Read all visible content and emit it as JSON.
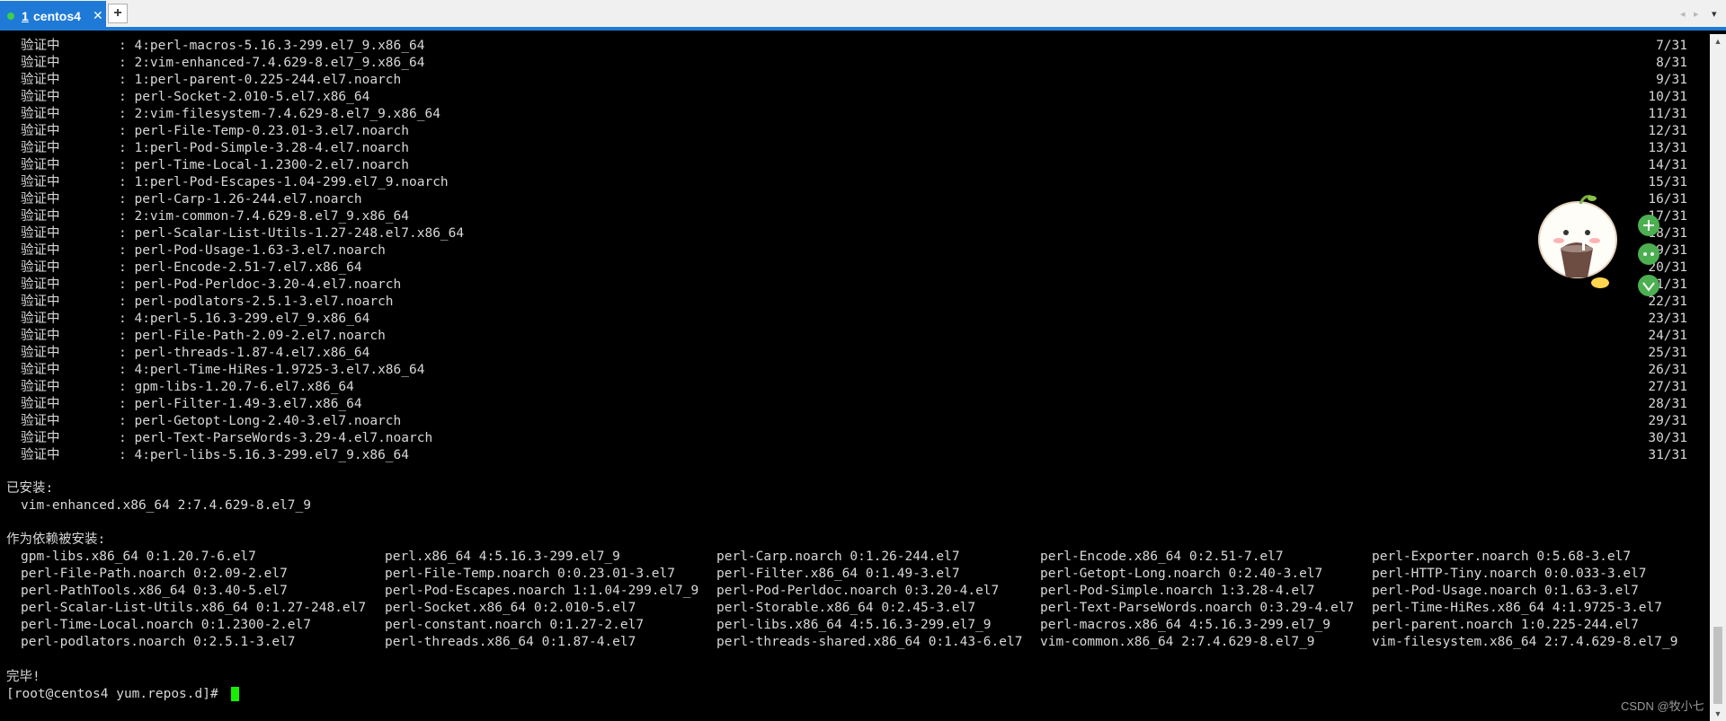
{
  "tab": {
    "number": "1",
    "name": "centos4",
    "close": "✕",
    "add": "+"
  },
  "tabbar_nav": {
    "left": "◂",
    "right": "▸",
    "menu": "▾"
  },
  "verify_rows": [
    {
      "label": "验证中",
      "pkg": ": 4:perl-macros-5.16.3-299.el7_9.x86_64",
      "progress": "7/31"
    },
    {
      "label": "验证中",
      "pkg": ": 2:vim-enhanced-7.4.629-8.el7_9.x86_64",
      "progress": "8/31"
    },
    {
      "label": "验证中",
      "pkg": ": 1:perl-parent-0.225-244.el7.noarch",
      "progress": "9/31"
    },
    {
      "label": "验证中",
      "pkg": ": perl-Socket-2.010-5.el7.x86_64",
      "progress": "10/31"
    },
    {
      "label": "验证中",
      "pkg": ": 2:vim-filesystem-7.4.629-8.el7_9.x86_64",
      "progress": "11/31"
    },
    {
      "label": "验证中",
      "pkg": ": perl-File-Temp-0.23.01-3.el7.noarch",
      "progress": "12/31"
    },
    {
      "label": "验证中",
      "pkg": ": 1:perl-Pod-Simple-3.28-4.el7.noarch",
      "progress": "13/31"
    },
    {
      "label": "验证中",
      "pkg": ": perl-Time-Local-1.2300-2.el7.noarch",
      "progress": "14/31"
    },
    {
      "label": "验证中",
      "pkg": ": 1:perl-Pod-Escapes-1.04-299.el7_9.noarch",
      "progress": "15/31"
    },
    {
      "label": "验证中",
      "pkg": ": perl-Carp-1.26-244.el7.noarch",
      "progress": "16/31"
    },
    {
      "label": "验证中",
      "pkg": ": 2:vim-common-7.4.629-8.el7_9.x86_64",
      "progress": "17/31"
    },
    {
      "label": "验证中",
      "pkg": ": perl-Scalar-List-Utils-1.27-248.el7.x86_64",
      "progress": "18/31"
    },
    {
      "label": "验证中",
      "pkg": ": perl-Pod-Usage-1.63-3.el7.noarch",
      "progress": "19/31"
    },
    {
      "label": "验证中",
      "pkg": ": perl-Encode-2.51-7.el7.x86_64",
      "progress": "20/31"
    },
    {
      "label": "验证中",
      "pkg": ": perl-Pod-Perldoc-3.20-4.el7.noarch",
      "progress": "21/31"
    },
    {
      "label": "验证中",
      "pkg": ": perl-podlators-2.5.1-3.el7.noarch",
      "progress": "22/31"
    },
    {
      "label": "验证中",
      "pkg": ": 4:perl-5.16.3-299.el7_9.x86_64",
      "progress": "23/31"
    },
    {
      "label": "验证中",
      "pkg": ": perl-File-Path-2.09-2.el7.noarch",
      "progress": "24/31"
    },
    {
      "label": "验证中",
      "pkg": ": perl-threads-1.87-4.el7.x86_64",
      "progress": "25/31"
    },
    {
      "label": "验证中",
      "pkg": ": 4:perl-Time-HiRes-1.9725-3.el7.x86_64",
      "progress": "26/31"
    },
    {
      "label": "验证中",
      "pkg": ": gpm-libs-1.20.7-6.el7.x86_64",
      "progress": "27/31"
    },
    {
      "label": "验证中",
      "pkg": ": perl-Filter-1.49-3.el7.x86_64",
      "progress": "28/31"
    },
    {
      "label": "验证中",
      "pkg": ": perl-Getopt-Long-2.40-3.el7.noarch",
      "progress": "29/31"
    },
    {
      "label": "验证中",
      "pkg": ": perl-Text-ParseWords-3.29-4.el7.noarch",
      "progress": "30/31"
    },
    {
      "label": "验证中",
      "pkg": ": 4:perl-libs-5.16.3-299.el7_9.x86_64",
      "progress": "31/31"
    }
  ],
  "installed": {
    "heading": "已安装:",
    "packages": [
      "vim-enhanced.x86_64 2:7.4.629-8.el7_9"
    ]
  },
  "dependencies": {
    "heading": "作为依赖被安装:",
    "rows": [
      [
        "gpm-libs.x86_64 0:1.20.7-6.el7",
        "perl.x86_64 4:5.16.3-299.el7_9",
        "perl-Carp.noarch 0:1.26-244.el7",
        "perl-Encode.x86_64 0:2.51-7.el7",
        "perl-Exporter.noarch 0:5.68-3.el7"
      ],
      [
        "perl-File-Path.noarch 0:2.09-2.el7",
        "perl-File-Temp.noarch 0:0.23.01-3.el7",
        "perl-Filter.x86_64 0:1.49-3.el7",
        "perl-Getopt-Long.noarch 0:2.40-3.el7",
        "perl-HTTP-Tiny.noarch 0:0.033-3.el7"
      ],
      [
        "perl-PathTools.x86_64 0:3.40-5.el7",
        "perl-Pod-Escapes.noarch 1:1.04-299.el7_9",
        "perl-Pod-Perldoc.noarch 0:3.20-4.el7",
        "perl-Pod-Simple.noarch 1:3.28-4.el7",
        "perl-Pod-Usage.noarch 0:1.63-3.el7"
      ],
      [
        "perl-Scalar-List-Utils.x86_64 0:1.27-248.el7",
        "perl-Socket.x86_64 0:2.010-5.el7",
        "perl-Storable.x86_64 0:2.45-3.el7",
        "perl-Text-ParseWords.noarch 0:3.29-4.el7",
        "perl-Time-HiRes.x86_64 4:1.9725-3.el7"
      ],
      [
        "perl-Time-Local.noarch 0:1.2300-2.el7",
        "perl-constant.noarch 0:1.27-2.el7",
        "perl-libs.x86_64 4:5.16.3-299.el7_9",
        "perl-macros.x86_64 4:5.16.3-299.el7_9",
        "perl-parent.noarch 1:0.225-244.el7"
      ],
      [
        "perl-podlators.noarch 0:2.5.1-3.el7",
        "perl-threads.x86_64 0:1.87-4.el7",
        "perl-threads-shared.x86_64 0:1.43-6.el7",
        "vim-common.x86_64 2:7.4.629-8.el7_9",
        "vim-filesystem.x86_64 2:7.4.629-8.el7_9"
      ]
    ]
  },
  "complete": "完毕!",
  "prompt": "[root@centos4 yum.repos.d]# ",
  "watermark": "CSDN @牧小七",
  "colors": {
    "accent": "#1e7ad6",
    "cursor": "#16f000",
    "text": "#d8d8d8",
    "background": "#000000"
  },
  "icons": {
    "tab_status": "green-dot-icon",
    "sticker": "cartoon-sticker-icon"
  }
}
